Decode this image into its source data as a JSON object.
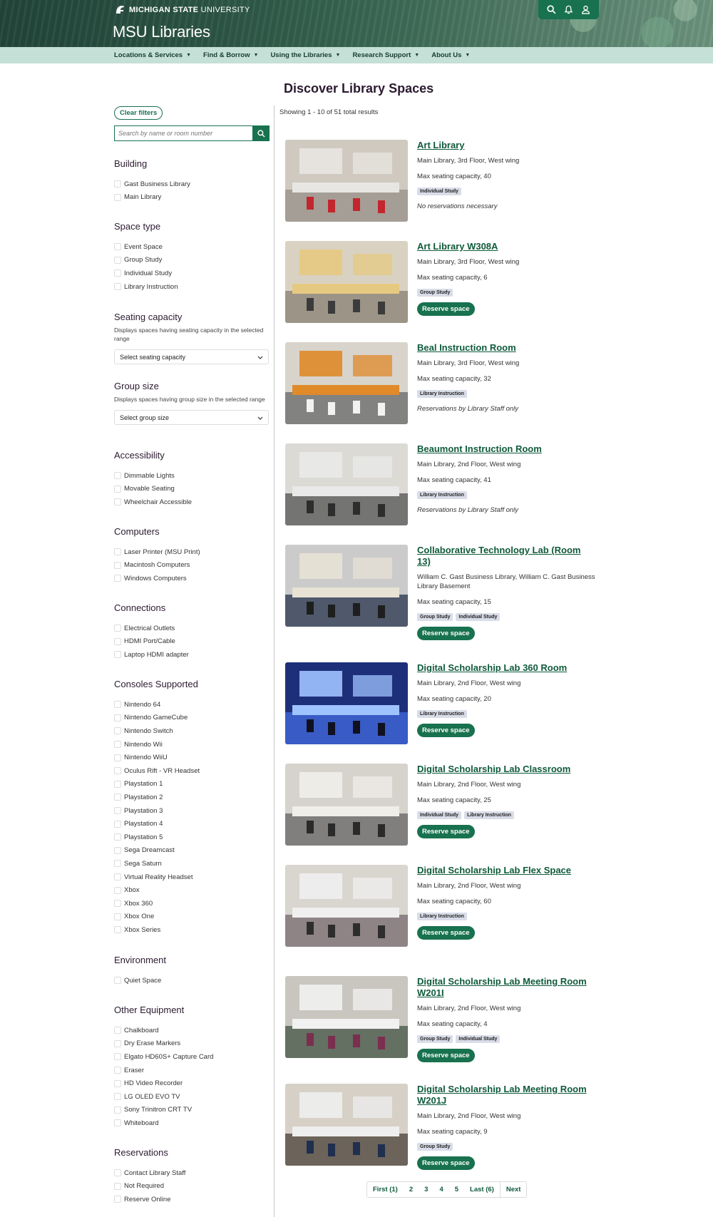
{
  "header": {
    "university_bold": "MICHIGAN STATE",
    "university_rest": " UNIVERSITY",
    "site_title": "MSU Libraries"
  },
  "nav": [
    "Locations & Services",
    "Find & Borrow",
    "Using the Libraries",
    "Research Support",
    "About Us"
  ],
  "page_title": "Discover Library Spaces",
  "filters": {
    "clear_label": "Clear filters",
    "search_placeholder": "Search by name or room number"
  },
  "filter_groups": {
    "building": {
      "title": "Building",
      "options": [
        "Gast Business Library",
        "Main Library"
      ]
    },
    "space_type": {
      "title": "Space type",
      "options": [
        "Event Space",
        "Group Study",
        "Individual Study",
        "Library Instruction"
      ]
    },
    "seating": {
      "title": "Seating capacity",
      "desc": "Displays spaces having seating capacity in the selected range",
      "select": "Select seating capacity"
    },
    "group_size": {
      "title": "Group size",
      "desc": "Displays spaces having group size in the selected range",
      "select": "Select group size"
    },
    "accessibility": {
      "title": "Accessibility",
      "options": [
        "Dimmable Lights",
        "Movable Seating",
        "Wheelchair Accessible"
      ]
    },
    "computers": {
      "title": "Computers",
      "options": [
        "Laser Printer (MSU Print)",
        "Macintosh Computers",
        "Windows Computers"
      ]
    },
    "connections": {
      "title": "Connections",
      "options": [
        "Electrical Outlets",
        "HDMI Port/Cable",
        "Laptop HDMI adapter"
      ]
    },
    "consoles": {
      "title": "Consoles Supported",
      "options": [
        "Nintendo 64",
        "Nintendo GameCube",
        "Nintendo Switch",
        "Nintendo Wii",
        "Nintendo WiiU",
        "Oculus Rift - VR Headset",
        "Playstation 1",
        "Playstation 2",
        "Playstation 3",
        "Playstation 4",
        "Playstation 5",
        "Sega Dreamcast",
        "Sega Saturn",
        "Virtual Reality Headset",
        "Xbox",
        "Xbox 360",
        "Xbox One",
        "Xbox Series"
      ]
    },
    "environment": {
      "title": "Environment",
      "options": [
        "Quiet Space"
      ]
    },
    "other_equipment": {
      "title": "Other Equipment",
      "options": [
        "Chalkboard",
        "Dry Erase Markers",
        "Elgato HD60S+ Capture Card",
        "Eraser",
        "HD Video Recorder",
        "LG OLED EVO TV",
        "Sony Trinitron CRT TV",
        "Whiteboard"
      ]
    },
    "reservations": {
      "title": "Reservations",
      "options": [
        "Contact Library Staff",
        "Not Required",
        "Reserve Online"
      ]
    }
  },
  "results": {
    "summary": "Showing 1 - 10 of 51 total results",
    "reserve_label": "Reserve space",
    "items": [
      {
        "name": "Art Library",
        "location": "Main Library, 3rd Floor, West wing",
        "capacity": "Max seating capacity, 40",
        "tags": [
          "Individual Study"
        ],
        "note": "No reservations necessary",
        "reservable": false
      },
      {
        "name": "Art Library W308A",
        "location": "Main Library, 3rd Floor, West wing",
        "capacity": "Max seating capacity, 6",
        "tags": [
          "Group Study"
        ],
        "note": "",
        "reservable": true
      },
      {
        "name": "Beal Instruction Room",
        "location": "Main Library, 3rd Floor, West wing",
        "capacity": "Max seating capacity, 32",
        "tags": [
          "Library Instruction"
        ],
        "note": "Reservations by Library Staff only",
        "reservable": false
      },
      {
        "name": "Beaumont Instruction Room",
        "location": "Main Library, 2nd Floor, West wing",
        "capacity": "Max seating capacity, 41",
        "tags": [
          "Library Instruction"
        ],
        "note": "Reservations by Library Staff only",
        "reservable": false
      },
      {
        "name": "Collaborative Technology Lab (Room 13)",
        "location": "William C. Gast Business Library, William C. Gast Business Library Basement",
        "capacity": "Max seating capacity, 15",
        "tags": [
          "Group Study",
          "Individual Study"
        ],
        "note": "",
        "reservable": true
      },
      {
        "name": "Digital Scholarship Lab 360 Room",
        "location": "Main Library, 2nd Floor, West wing",
        "capacity": "Max seating capacity, 20",
        "tags": [
          "Library Instruction"
        ],
        "note": "",
        "reservable": true
      },
      {
        "name": "Digital Scholarship Lab Classroom",
        "location": "Main Library, 2nd Floor, West wing",
        "capacity": "Max seating capacity, 25",
        "tags": [
          "Individual Study",
          "Library Instruction"
        ],
        "note": "",
        "reservable": true
      },
      {
        "name": "Digital Scholarship Lab Flex Space",
        "location": "Main Library, 2nd Floor, West wing",
        "capacity": "Max seating capacity, 60",
        "tags": [
          "Library Instruction"
        ],
        "note": "",
        "reservable": true
      },
      {
        "name": "Digital Scholarship Lab Meeting Room W201I",
        "location": "Main Library, 2nd Floor, West wing",
        "capacity": "Max seating capacity, 4",
        "tags": [
          "Group Study",
          "Individual Study"
        ],
        "note": "",
        "reservable": true
      },
      {
        "name": "Digital Scholarship Lab Meeting Room W201J",
        "location": "Main Library, 2nd Floor, West wing",
        "capacity": "Max seating capacity, 9",
        "tags": [
          "Group Study"
        ],
        "note": "",
        "reservable": true
      }
    ]
  },
  "pagination": [
    "First (1)",
    "2",
    "3",
    "4",
    "5",
    "Last (6)",
    "Next"
  ],
  "colors": {
    "accent": "#18714f",
    "nav_bg": "#c5e0d6",
    "heading": "#2b1a2f"
  }
}
